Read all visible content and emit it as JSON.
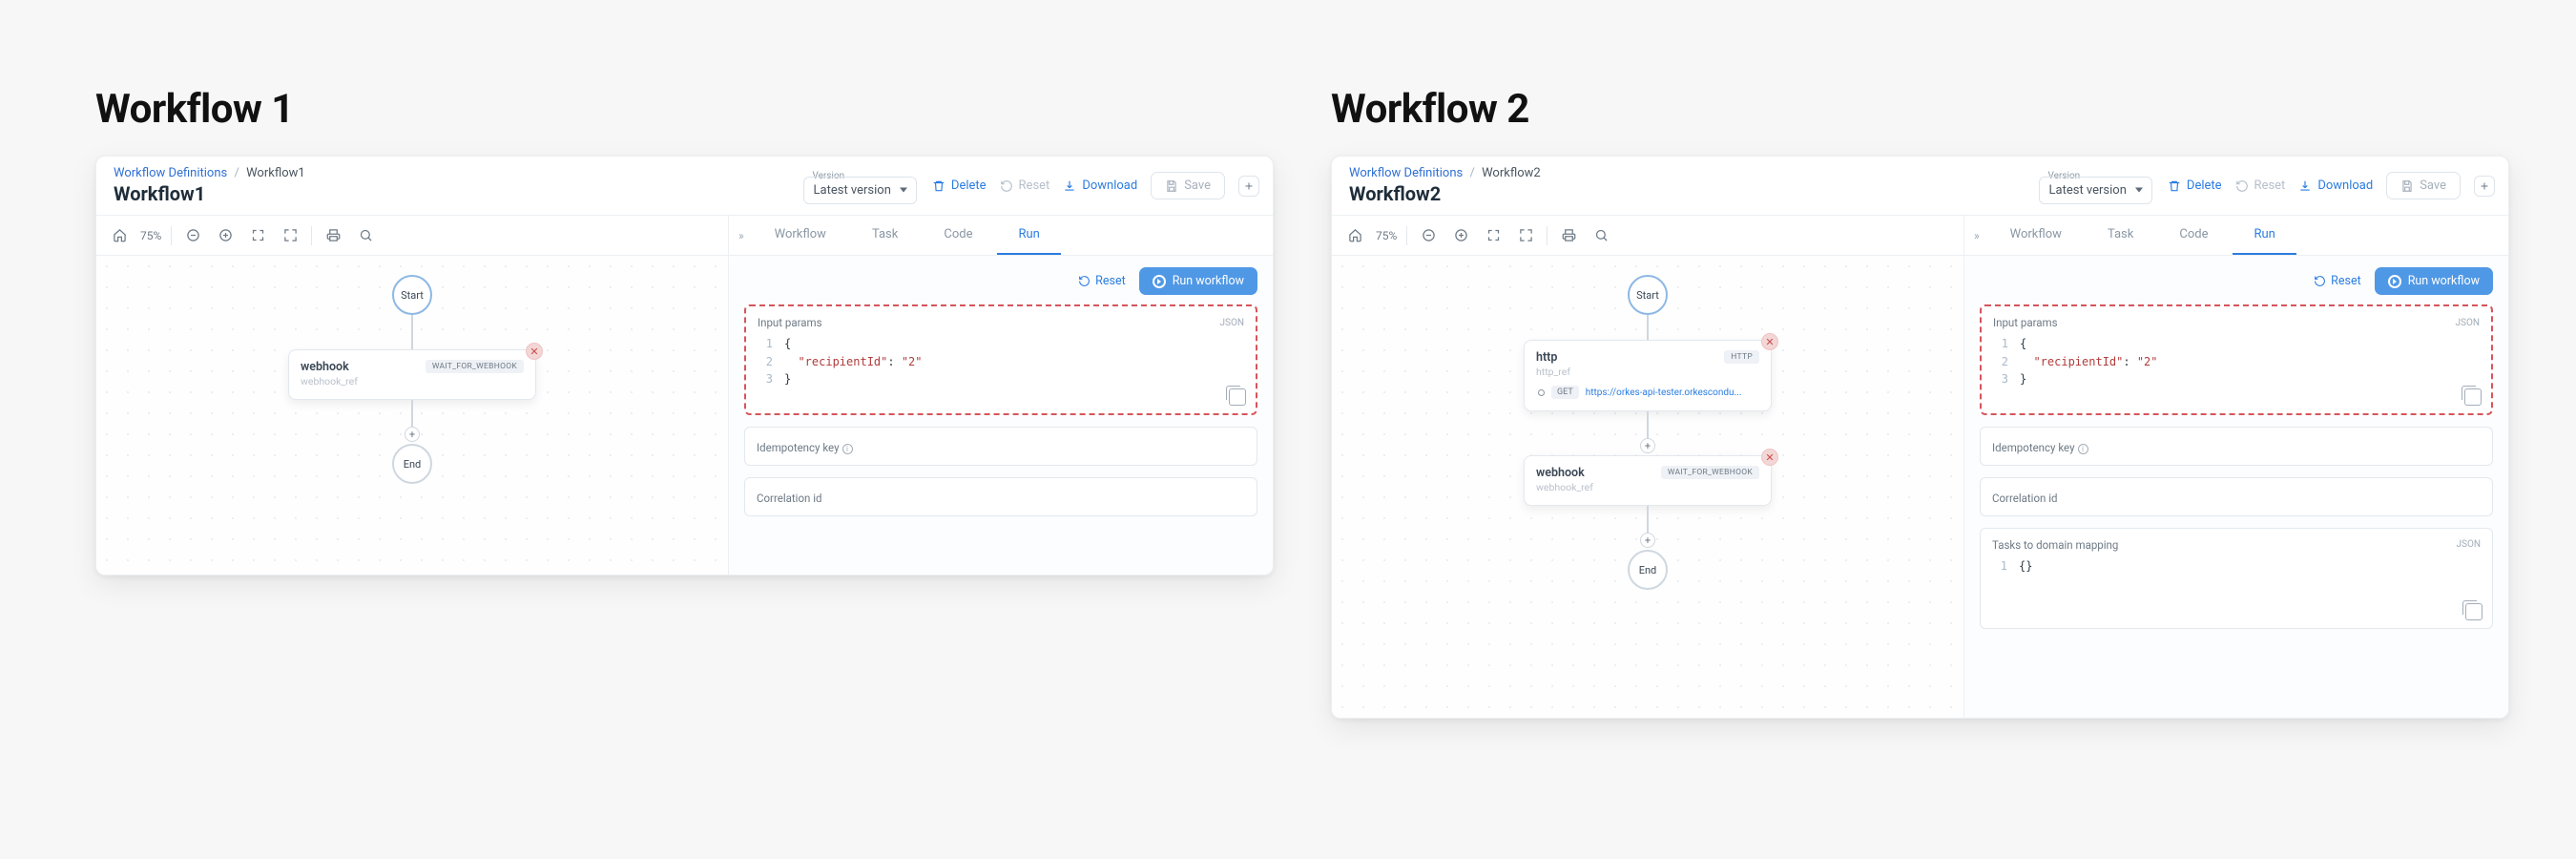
{
  "columns": [
    {
      "title": "Workflow 1"
    },
    {
      "title": "Workflow 2"
    }
  ],
  "breadcrumbs": {
    "root": "Workflow Definitions",
    "sep": "/"
  },
  "workflows": {
    "w1": {
      "crumb": "Workflow1",
      "title": "Workflow1"
    },
    "w2": {
      "crumb": "Workflow2",
      "title": "Workflow2"
    }
  },
  "version": {
    "label": "Version",
    "selected": "Latest version"
  },
  "topActions": {
    "delete": "Delete",
    "reset": "Reset",
    "download": "Download",
    "save": "Save"
  },
  "zoom": "75%",
  "tabs": {
    "workflow": "Workflow",
    "task": "Task",
    "code": "Code",
    "run": "Run"
  },
  "rightbar": {
    "reset": "Reset",
    "run": "Run workflow"
  },
  "canvas": {
    "start": "Start",
    "end": "End"
  },
  "task_webhook": {
    "name": "webhook",
    "ref": "webhook_ref",
    "badge": "WAIT_FOR_WEBHOOK"
  },
  "task_http": {
    "name": "http",
    "ref": "http_ref",
    "badge": "HTTP",
    "method": "GET",
    "url": "https://orkes-api-tester.orkescondu..."
  },
  "inputParams": {
    "label": "Input params",
    "tag": "JSON",
    "lines": {
      "l1": "{",
      "l2_key": "\"recipientId\"",
      "l2_colon": ": ",
      "l2_val": "\"2\"",
      "l3": "}"
    }
  },
  "idem": {
    "label": "Idempotency key"
  },
  "corr": {
    "label": "Correlation id"
  },
  "taskmap": {
    "label": "Tasks to domain mapping",
    "tag": "JSON",
    "line1": "{}"
  }
}
